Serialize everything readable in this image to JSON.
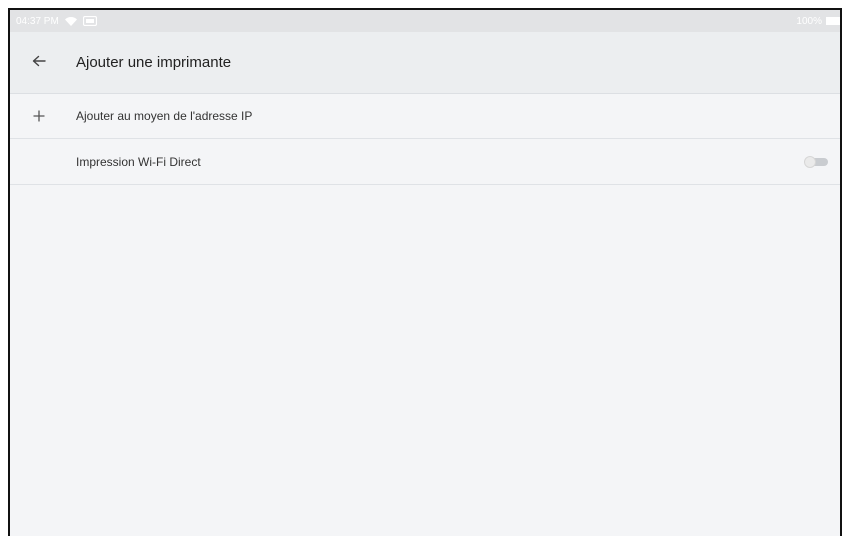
{
  "status_bar": {
    "time": "04:37 PM",
    "battery_text": "100%"
  },
  "app_bar": {
    "title": "Ajouter une imprimante",
    "back_icon": "arrow-left-icon"
  },
  "rows": [
    {
      "icon": "plus-icon",
      "label": "Ajouter au moyen de l'adresse IP"
    },
    {
      "label": "Impression Wi-Fi Direct",
      "toggle_on": false
    }
  ],
  "colors": {
    "background": "#f4f5f7",
    "app_bar": "#eceef0",
    "toggle_track_off": "#c9ccd0"
  }
}
